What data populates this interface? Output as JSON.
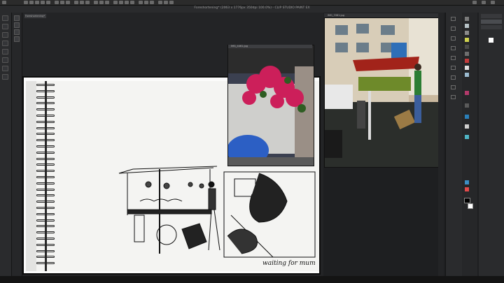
{
  "app": {
    "title": "Foreshortening* (2063 x 1776px 350dpi 100.0%) - CLIP STUDIO PAINT EX",
    "document_tab": "Foreshortening*"
  },
  "references": {
    "photo1_tab": "IMG_4461.jpg",
    "photo2_tab": "IMG_3381.jpg"
  },
  "sketch": {
    "caption": "waiting for mum"
  },
  "colors": {
    "main": "#000000",
    "sub": "#ffffff",
    "accent": "#2f7fb8"
  },
  "icons": {
    "left_tools": [
      "pen-tool-icon",
      "brush-tool-icon",
      "eraser-tool-icon",
      "selection-tool-icon",
      "move-tool-icon",
      "fill-tool-icon",
      "text-tool-icon",
      "eyedropper-tool-icon",
      "zoom-tool-icon"
    ],
    "right_tools": [
      "layer-icon",
      "palette-icon",
      "navigator-icon",
      "history-icon"
    ]
  }
}
